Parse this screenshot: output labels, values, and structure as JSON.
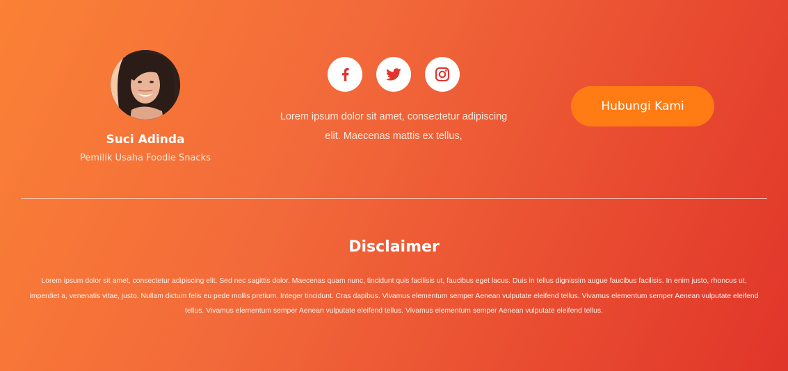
{
  "profile": {
    "name": "Suci Adinda",
    "role": "Pemilik Usaha Foodie Snacks"
  },
  "socials": [
    {
      "icon": "facebook-icon"
    },
    {
      "icon": "twitter-icon"
    },
    {
      "icon": "instagram-icon"
    }
  ],
  "tagline": "Lorem ipsum dolor sit amet, consectetur adipiscing elit. Maecenas mattis ex tellus,",
  "cta": {
    "label": "Hubungi Kami"
  },
  "disclaimer": {
    "title": "Disclaimer",
    "text": "Lorem ipsum dolor sit amet, consectetur adipiscing elit. Sed nec sagittis dolor. Maecenas quam nunc, tincidunt quis facilisis ut, faucibus eget lacus. Duis in tellus dignissim augue faucibus facilisis. In enim justo, rhoncus ut, imperdiet a, venenatis vitae, justo. Nullam dictum felis eu pede mollis pretium. Integer tincidunt. Cras dapibus. Vivamus elementum semper Aenean vulputate eleifend tellus. Vivamus elementum semper Aenean vulputate eleifend tellus. Vivamus elementum semper Aenean vulputate eleifend tellus. Vivamus elementum semper Aenean vulputate eleifend tellus."
  },
  "colors": {
    "gradient_start": "#fb8136",
    "gradient_end": "#e0352a",
    "button": "#ff7b14",
    "icon": "#e2352d"
  }
}
